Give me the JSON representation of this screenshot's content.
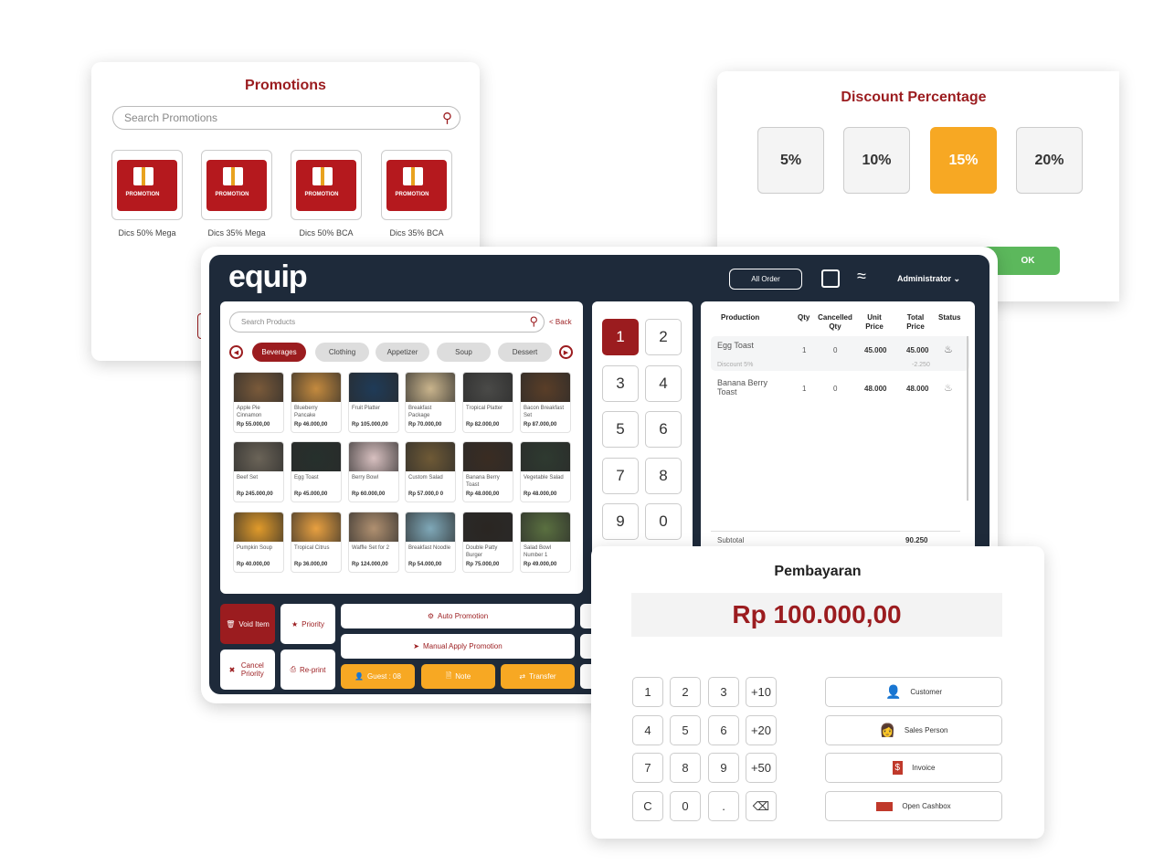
{
  "promotions": {
    "title": "Promotions",
    "search_placeholder": "Search Promotions",
    "badge_text": "PROMOTION",
    "items": [
      {
        "label": "Dics 50% Mega"
      },
      {
        "label": "Dics 35% Mega"
      },
      {
        "label": "Dics 50% BCA"
      },
      {
        "label": "Dics 35% BCA"
      }
    ]
  },
  "discount": {
    "title": "Discount Percentage",
    "options": [
      "5%",
      "10%",
      "15%",
      "20%"
    ],
    "selected": "15%",
    "ok_label": "OK",
    "accent": "#f7a823"
  },
  "pos": {
    "logo": "equip",
    "all_order": "All Order",
    "user": "Administrator",
    "search_placeholder": "Search Products",
    "back": "< Back",
    "categories": [
      "Beverages",
      "Clothing",
      "Appetizer",
      "Soup",
      "Dessert"
    ],
    "selected_category": "Beverages",
    "products": [
      {
        "name": "Apple Pie Cinnamon",
        "price": "Rp 55.000,00",
        "color": "#7a5a3a"
      },
      {
        "name": "Blueberry Pancake",
        "price": "Rp 46.000,00",
        "color": "#c48a3e"
      },
      {
        "name": "Fruit Platter",
        "price": "Rp 105.000,00",
        "color": "#1f3b58"
      },
      {
        "name": "Breakfast Package",
        "price": "Rp 70.000,00",
        "color": "#c9b48c"
      },
      {
        "name": "Tropical Platter",
        "price": "Rp 82.000,00",
        "color": "#4a4a48"
      },
      {
        "name": "Bacon Breakfast Set",
        "price": "Rp 87.000,00",
        "color": "#5a3e28"
      },
      {
        "name": "Beef Set",
        "price": "Rp 245.000,00",
        "color": "#6b6458"
      },
      {
        "name": "Egg Toast",
        "price": "Rp 45.000,00",
        "color": "#26302c"
      },
      {
        "name": "Berry Bowl",
        "price": "Rp 60.000,00",
        "color": "#d8c0c0"
      },
      {
        "name": "Custom Salad",
        "price": "Rp 57.000,0 0",
        "color": "#6f5a36"
      },
      {
        "name": "Banana Berry Toast",
        "price": "Rp 48.000,00",
        "color": "#3a2c22"
      },
      {
        "name": "Vegetable Salad",
        "price": "Rp 48.000,00",
        "color": "#2e3a30"
      },
      {
        "name": "Pumpkin Soup",
        "price": "Rp 40.000,00",
        "color": "#e09a2a"
      },
      {
        "name": "Tropical Citrus",
        "price": "Rp 36.000,00",
        "color": "#e8a040"
      },
      {
        "name": "Waffle Set for 2",
        "price": "Rp 124.000,00",
        "color": "#b09070"
      },
      {
        "name": "Breakfast Noodle",
        "price": "Rp 54.000,00",
        "color": "#7fa8b8"
      },
      {
        "name": "Double Patty Burger",
        "price": "Rp 75.000,00",
        "color": "#2a2622"
      },
      {
        "name": "Salad Bowl Number 1",
        "price": "Rp 49.000,00",
        "color": "#5a7040"
      }
    ],
    "numpad": [
      "1",
      "2",
      "3",
      "4",
      "5",
      "6",
      "7",
      "8",
      "9",
      "0"
    ],
    "numpad_selected": "1",
    "order": {
      "headers": [
        "Production",
        "Qty",
        "Cancelled Qty",
        "Unit Price",
        "Total Price",
        "Status"
      ],
      "rows": [
        {
          "name": "Egg Toast",
          "qty": "1",
          "cancelled": "0",
          "unit": "45.000",
          "total": "45.000",
          "discount_label": "Discount 5%",
          "discount_value": "-2.250"
        },
        {
          "name": "Banana Berry Toast",
          "qty": "1",
          "cancelled": "0",
          "unit": "48.000",
          "total": "48.000"
        }
      ],
      "subtotal_label": "Subtotal",
      "subtotal": "90.250"
    },
    "actions": {
      "void": "Void Item",
      "priority": "Priority",
      "cancel_priority": "Cancel Priority",
      "reprint": "Re-print",
      "auto_promo": "Auto Promotion",
      "manual_promo": "Manual Apply Promotion",
      "guest": "Guest : 08",
      "note": "Note",
      "transfer": "Transfer"
    }
  },
  "payment": {
    "title": "Pembayaran",
    "amount": "Rp 100.000,00",
    "keys": [
      "1",
      "2",
      "3",
      "+10",
      "4",
      "5",
      "6",
      "+20",
      "7",
      "8",
      "9",
      "+50",
      "C",
      "0",
      ".",
      "⌫"
    ],
    "buttons": [
      "Customer",
      "Sales Person",
      "Invoice",
      "Open Cashbox"
    ]
  }
}
